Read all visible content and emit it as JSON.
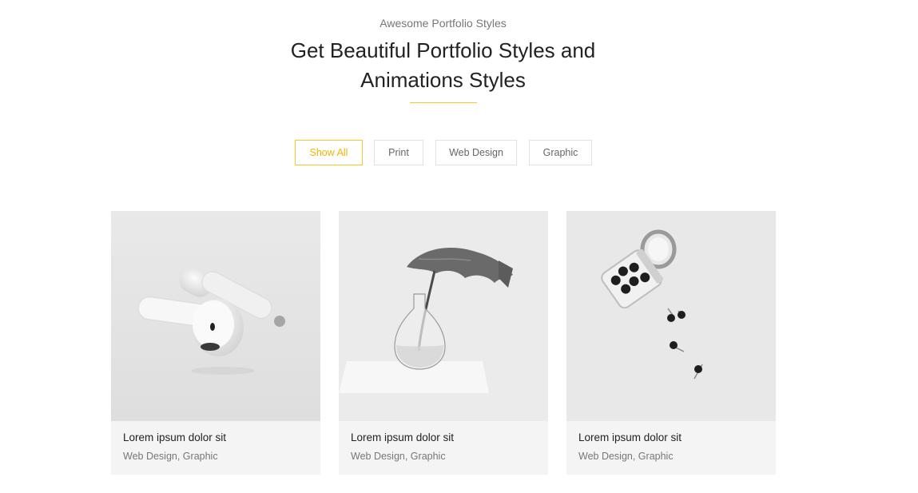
{
  "header": {
    "subtitle": "Awesome Portfolio Styles",
    "title_line1": "Get Beautiful Portfolio Styles and",
    "title_line2": "Animations Styles"
  },
  "filters": [
    {
      "label": "Show All",
      "active": true
    },
    {
      "label": "Print",
      "active": false
    },
    {
      "label": "Web Design",
      "active": false
    },
    {
      "label": "Graphic",
      "active": false
    }
  ],
  "cards": [
    {
      "title": "Lorem ipsum dolor sit",
      "categories": "Web Design, Graphic",
      "image": "earbuds-photo"
    },
    {
      "title": "Lorem ipsum dolor sit",
      "categories": "Web Design, Graphic",
      "image": "plant-vase-photo"
    },
    {
      "title": "Lorem ipsum dolor sit",
      "categories": "Web Design, Graphic",
      "image": "pins-jar-photo"
    }
  ],
  "colors": {
    "accent": "#f4c82a",
    "card_background": "#f4f4f4",
    "title_text": "#222222",
    "muted_text": "#777777"
  }
}
